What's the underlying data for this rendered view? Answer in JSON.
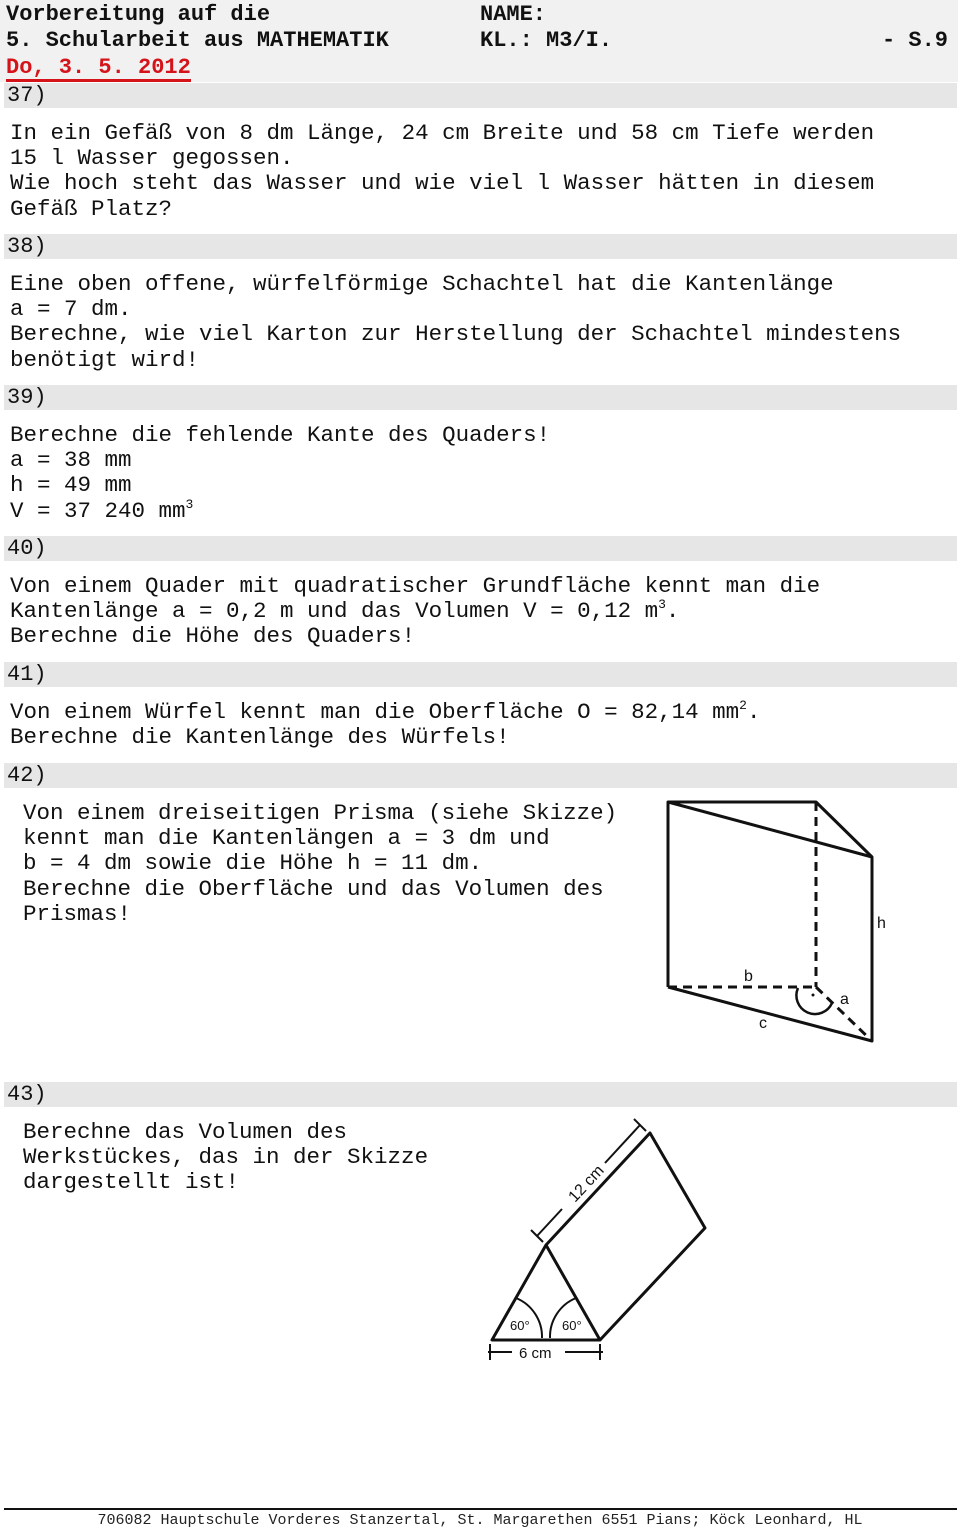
{
  "header": {
    "line1": "Vorbereitung auf die",
    "line2": "5. Schularbeit aus MATHEMATIK",
    "date": "Do, 3. 5. 2012",
    "name_label": "NAME:",
    "class_label": "KL.: M3/I.",
    "page": "- S.9"
  },
  "colors": {
    "date": "#d4141a",
    "band": "#e6e6e6"
  },
  "questions": {
    "q37": {
      "number": "37)",
      "lines": [
        "In ein Gefäß von 8 dm Länge, 24 cm Breite und 58 cm Tiefe werden",
        "15 l Wasser gegossen.",
        "Wie hoch steht das Wasser und wie viel l Wasser hätten in diesem",
        "Gefäß Platz?"
      ]
    },
    "q38": {
      "number": "38)",
      "lines": [
        "Eine oben offene, würfelförmige Schachtel hat die Kantenlänge",
        "a = 7 dm.",
        "Berechne, wie viel Karton zur Herstellung der Schachtel mindestens",
        "benötigt wird!"
      ]
    },
    "q39": {
      "number": "39)",
      "lines": [
        "Berechne die fehlende Kante des Quaders!",
        "a = 38 mm",
        "h = 49 mm",
        "V = 37 240 mm"
      ],
      "sup": "3"
    },
    "q40": {
      "number": "40)",
      "line1": "Von einem Quader mit quadratischer Grundfläche kennt man die",
      "line2a": "Kantenlänge a = 0,2 m und das Volumen V = 0,12 m",
      "sup": "3",
      "line2b": ".",
      "line3": "Berechne die Höhe des Quaders!"
    },
    "q41": {
      "number": "41)",
      "line1a": "Von einem Würfel kennt man die Oberfläche O = 82,14 mm",
      "sup": "2",
      "line1b": ".",
      "line2": "Berechne die Kantenlänge des Würfels!"
    },
    "q42": {
      "number": "42)",
      "lines": [
        "Von einem dreiseitigen Prisma (siehe Skizze)",
        "kennt man die Kantenlängen a = 3 dm und",
        "b = 4 dm sowie die Höhe h = 11 dm.",
        "Berechne die Oberfläche und das Volumen des",
        "Prismas!"
      ],
      "figure_labels": {
        "h": "h",
        "b": "b",
        "a": "a",
        "c": "c"
      }
    },
    "q43": {
      "number": "43)",
      "lines": [
        "Berechne das Volumen des",
        "Werkstückes, das in der Skizze",
        "dargestellt ist!"
      ],
      "figure_labels": {
        "length": "12 cm",
        "base": "6 cm",
        "angle_left": "60°",
        "angle_right": "60°"
      }
    }
  },
  "footer": "706082 Hauptschule Vorderes Stanzertal, St. Margarethen 6551 Pians; Köck Leonhard, HL"
}
